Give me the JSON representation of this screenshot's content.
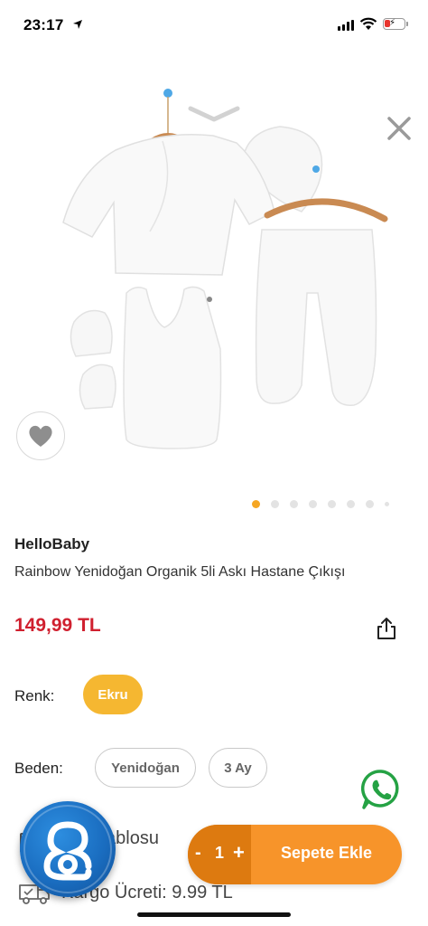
{
  "status_bar": {
    "time": "23:17"
  },
  "product": {
    "brand": "HelloBaby",
    "name": "Rainbow Yenidoğan Organik 5li Askı Hastane Çıkışı",
    "price": "149,99 TL",
    "image_count": 8,
    "current_image_index": 1
  },
  "options": {
    "color_label": "Renk:",
    "colors": [
      {
        "label": "Ekru",
        "selected": true
      }
    ],
    "size_label": "Beden:",
    "sizes": [
      {
        "label": "Yenidoğan",
        "selected": false
      },
      {
        "label": "3 Ay",
        "selected": false
      }
    ]
  },
  "info": {
    "size_chart_label": "Beden Tablosu",
    "shipping_label": "Kargo Ücreti: 9.99 TL"
  },
  "cart": {
    "minus": "-",
    "quantity": "1",
    "plus": "+",
    "add_label": "Sepete Ekle"
  },
  "icons": {
    "close": "close-icon",
    "favorite": "heart-icon",
    "share": "share-icon",
    "whatsapp": "whatsapp-icon",
    "chat": "chat-support-icon",
    "truck": "truck-icon"
  },
  "colors": {
    "accent": "#f5a623",
    "price": "#d0202f",
    "cart": "#f7942a",
    "cart_stepper": "#dd7a10",
    "whatsapp": "#25a244"
  }
}
